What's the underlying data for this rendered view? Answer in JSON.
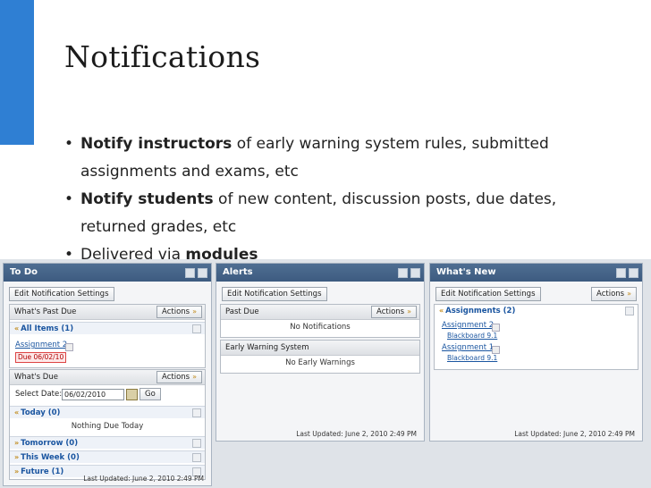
{
  "slide": {
    "title": "Notifications",
    "bullets": [
      {
        "bold": "Notify instructors",
        "text": " of early warning system rules, submitted assignments and exams, etc"
      },
      {
        "bold": "Notify students",
        "text": " of new content, discussion posts, due dates, returned grades, etc"
      },
      {
        "lead": "Delivered via ",
        "bold": "modules"
      }
    ]
  },
  "todo": {
    "title": "To Do",
    "edit_btn": "Edit Notification Settings",
    "past_due": {
      "header": "What's Past Due",
      "actions": "Actions",
      "group": "All Items (1)",
      "item": "Assignment 2",
      "badge": "Due 06/02/10"
    },
    "due": {
      "header": "What's Due",
      "actions": "Actions",
      "select_label": "Select Date:",
      "date_value": "06/02/2010",
      "go": "Go",
      "today": "Today (0)",
      "nothing": "Nothing Due Today",
      "tomorrow": "Tomorrow (0)",
      "this_week": "This Week (0)",
      "future": "Future (1)"
    },
    "footer": "Last Updated: June 2, 2010 2:49 PM"
  },
  "alerts": {
    "title": "Alerts",
    "edit_btn": "Edit Notification Settings",
    "past_due": {
      "header": "Past Due",
      "actions": "Actions",
      "empty": "No Notifications"
    },
    "ews": {
      "header": "Early Warning System",
      "empty": "No Early Warnings"
    },
    "footer": "Last Updated: June 2, 2010 2:49 PM"
  },
  "whatsnew": {
    "title": "What's New",
    "edit_btn": "Edit Notification Settings",
    "actions": "Actions",
    "group": "Assignments (2)",
    "items": [
      {
        "name": "Assignment 2",
        "course": "Blackboard 9.1"
      },
      {
        "name": "Assignment 1",
        "course": "Blackboard 9.1"
      }
    ],
    "footer": "Last Updated: June 2, 2010 2:49 PM"
  },
  "colors": {
    "accent": "#2f7fd3",
    "portlet_header": "#3d5b80",
    "link": "#1a55a0",
    "due_badge": "#b00000"
  }
}
